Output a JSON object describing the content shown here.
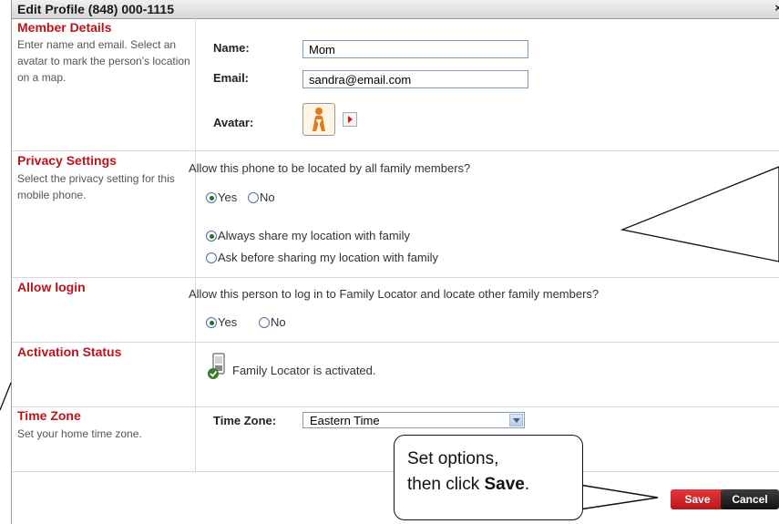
{
  "window": {
    "title": "Edit Profile (848) 000-1115",
    "close_label": "×"
  },
  "member": {
    "title": "Member Details",
    "desc": "Enter name and email. Select an avatar to mark the person's location on a map.",
    "name_label": "Name:",
    "name_value": "Mom",
    "email_label": "Email:",
    "email_value": "sandra@email.com",
    "avatar_label": "Avatar:"
  },
  "privacy": {
    "title": "Privacy Settings",
    "desc": "Select the privacy setting for this mobile phone.",
    "question": "Allow this phone to be located by all family members?",
    "yes": "Yes",
    "no": "No",
    "always": "Always share my location with family",
    "ask": "Ask before sharing my location with family"
  },
  "login": {
    "title": "Allow login",
    "question": "Allow this person to log in to Family Locator and locate other family members?",
    "yes": "Yes",
    "no": "No"
  },
  "activation": {
    "title": "Activation Status",
    "status": "Family Locator is activated."
  },
  "timezone": {
    "title": "Time Zone",
    "desc": "Set your home time zone.",
    "label": "Time Zone:",
    "value": "Eastern Time"
  },
  "actions": {
    "save": "Save",
    "cancel": "Cancel"
  },
  "callout": {
    "line1": "Set options,",
    "line2_prefix": "then click ",
    "line2_bold": "Save",
    "line2_suffix": "."
  },
  "colors": {
    "section_title": "#c0121b",
    "save_button": "#c8181d",
    "cancel_button": "#1e1e1e"
  }
}
